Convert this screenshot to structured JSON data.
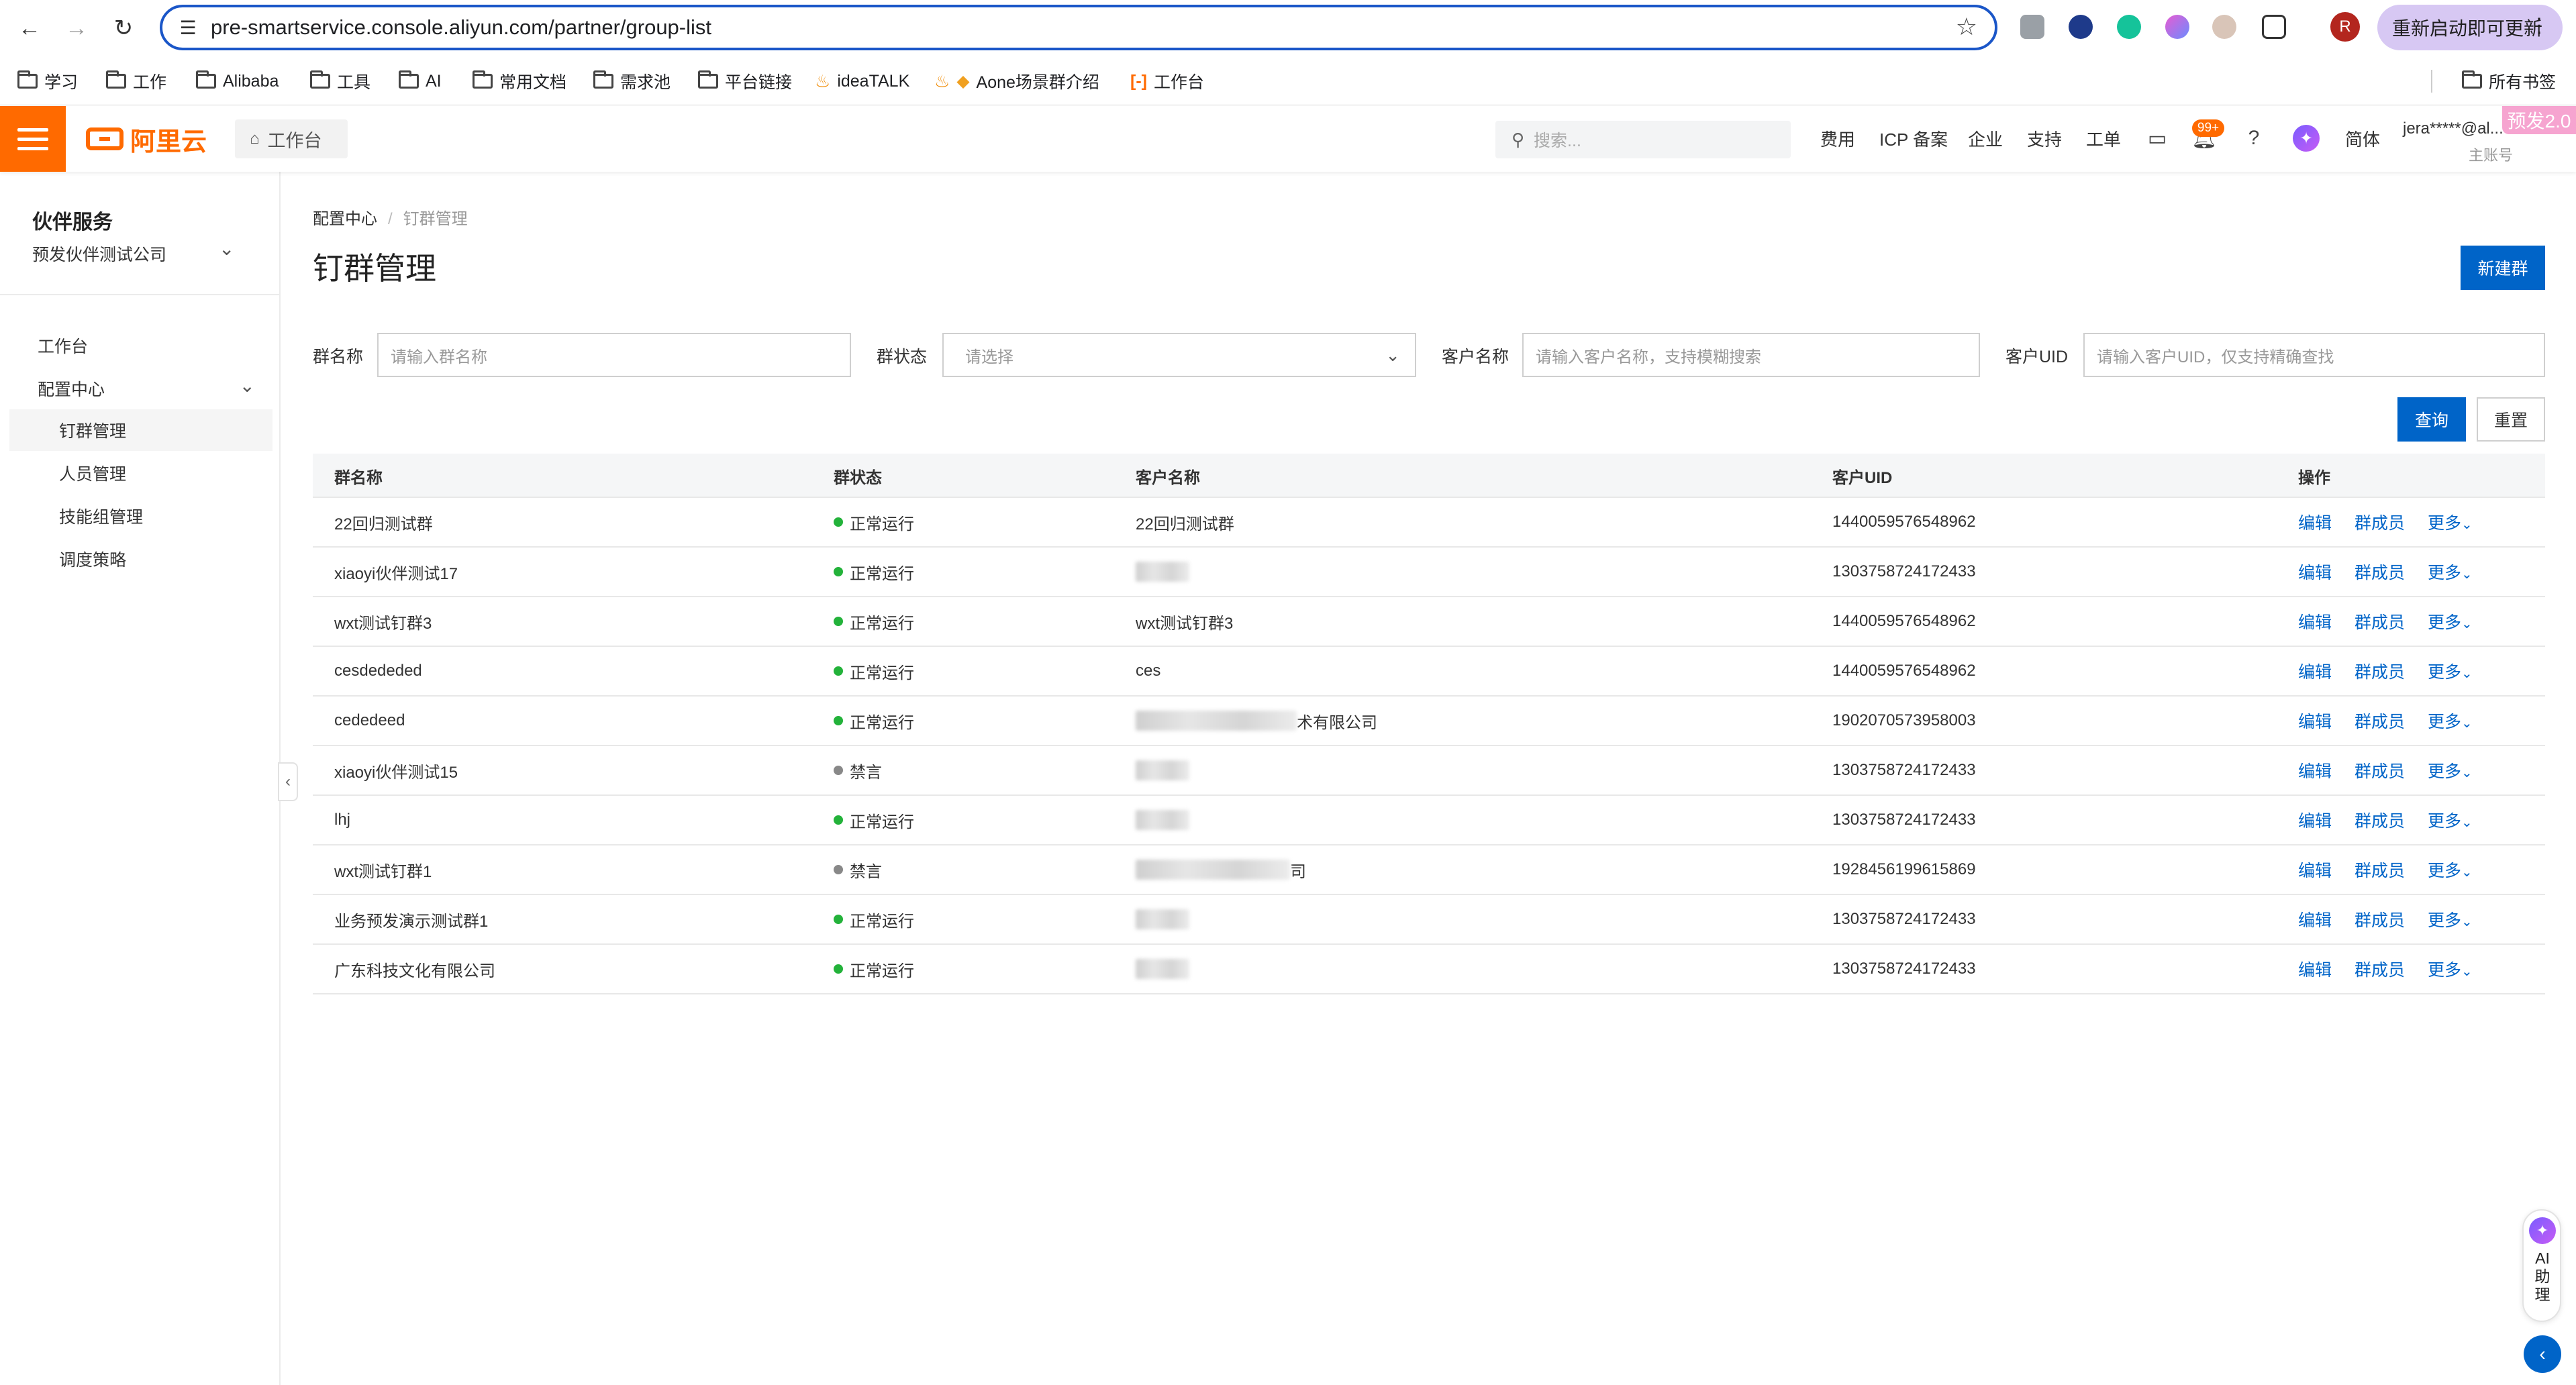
{
  "browser": {
    "url": "pre-smartservice.console.aliyun.com/partner/group-list",
    "profile_initial": "R",
    "relaunch_label": "重新启动即可更新",
    "bookmarks": [
      "学习",
      "工作",
      "Alibaba",
      "工具",
      "AI",
      "常用文档",
      "需求池",
      "平台链接",
      "ideaTALK",
      "Aone场景群介绍",
      "工作台"
    ],
    "all_bookmarks": "所有书签"
  },
  "topbar": {
    "logo": "阿里云",
    "workbench": "工作台",
    "search_placeholder": "搜索...",
    "nav": [
      "费用",
      "ICP 备案",
      "企业",
      "支持",
      "工单"
    ],
    "bell_badge": "99+",
    "lang": "简体",
    "user": "jera*****@al...",
    "user_sub": "主账号",
    "env_tag": "预发2.0"
  },
  "sidebar": {
    "title": "伙伴服务",
    "company": "预发伙伴测试公司",
    "items": [
      {
        "label": "工作台"
      },
      {
        "label": "配置中心"
      },
      {
        "label": "钉群管理"
      },
      {
        "label": "人员管理"
      },
      {
        "label": "技能组管理"
      },
      {
        "label": "调度策略"
      }
    ]
  },
  "breadcrumb": {
    "parent": "配置中心",
    "sep": "/",
    "current": "钉群管理"
  },
  "page_title": "钉群管理",
  "new_group_label": "新建群",
  "filters": {
    "group_name_label": "群名称",
    "group_name_placeholder": "请输入群名称",
    "status_label": "群状态",
    "status_placeholder": "请选择",
    "customer_label": "客户名称",
    "customer_placeholder": "请输入客户名称，支持模糊搜索",
    "uid_label": "客户UID",
    "uid_placeholder": "请输入客户UID，仅支持精确查找"
  },
  "query_label": "查询",
  "reset_label": "重置",
  "table": {
    "headers": [
      "群名称",
      "群状态",
      "客户名称",
      "客户UID",
      "操作"
    ],
    "rows": [
      {
        "name": "22回归测试群",
        "status": "正常运行",
        "customer": "22回归测试群",
        "uid": "1440059576548962"
      },
      {
        "name": "xiaoyi伙伴测试17",
        "status": "正常运行",
        "customer": "",
        "uid": "1303758724172433"
      },
      {
        "name": "wxt测试钉群3",
        "status": "正常运行",
        "customer": "wxt测试钉群3",
        "uid": "1440059576548962"
      },
      {
        "name": "cesdededed",
        "status": "正常运行",
        "customer": "ces",
        "uid": "1440059576548962"
      },
      {
        "name": "cededeed",
        "status": "正常运行",
        "customer": "术有限公司",
        "uid": "1902070573958003"
      },
      {
        "name": "xiaoyi伙伴测试15",
        "status": "禁言",
        "customer": "",
        "uid": "1303758724172433"
      },
      {
        "name": "lhj",
        "status": "正常运行",
        "customer": "",
        "uid": "1303758724172433"
      },
      {
        "name": "wxt测试钉群1",
        "status": "禁言",
        "customer": "司",
        "uid": "1928456199615869"
      },
      {
        "name": "业务预发演示测试群1",
        "status": "正常运行",
        "customer": "",
        "uid": "1303758724172433"
      },
      {
        "name": "广东科技文化有限公司",
        "status": "正常运行",
        "customer": "",
        "uid": "1303758724172433"
      }
    ],
    "actions": [
      "编辑",
      "群成员",
      "更多"
    ]
  },
  "ai_assistant_label": "AI助理",
  "colors": {
    "brand": "#ff6a00",
    "primary": "#0064c8",
    "running": "#23b23a",
    "muted": "#888888"
  }
}
